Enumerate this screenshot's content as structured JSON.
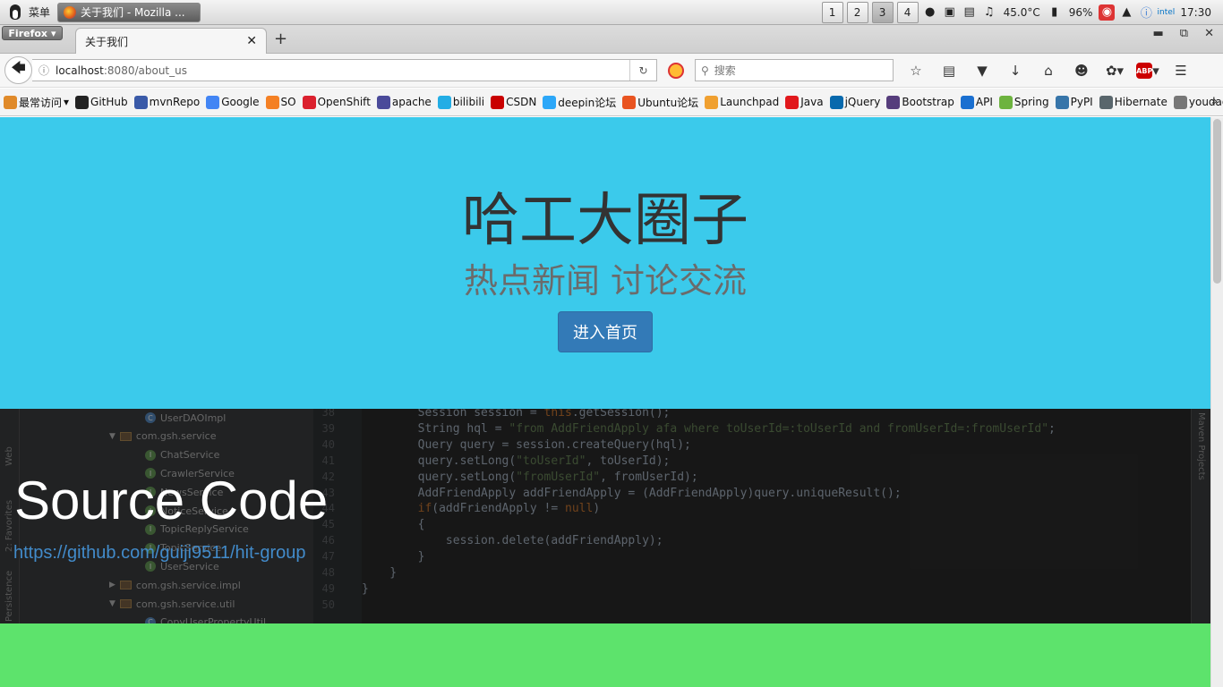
{
  "system_panel": {
    "menu_label": "菜单",
    "task_title": "关于我们 - Mozilla ...",
    "workspaces": [
      "1",
      "2",
      "3",
      "4"
    ],
    "active_workspace": "3",
    "temperature": "45.0°C",
    "battery": "96%",
    "clock": "17:30"
  },
  "browser": {
    "app_menu": "Firefox",
    "tab_title": "关于我们",
    "url_host": "localhost",
    "url_path": ":8080/about_us",
    "search_placeholder": "搜索"
  },
  "bookmarks": [
    {
      "label": "最常访问",
      "color": "#e08a2a"
    },
    {
      "label": "GitHub",
      "color": "#222222"
    },
    {
      "label": "mvnRepo",
      "color": "#3a5aa8"
    },
    {
      "label": "Google",
      "color": "#4285f4"
    },
    {
      "label": "SO",
      "color": "#f48024"
    },
    {
      "label": "OpenShift",
      "color": "#db212e"
    },
    {
      "label": "apache",
      "color": "#4a4a9a"
    },
    {
      "label": "bilibili",
      "color": "#23ade5"
    },
    {
      "label": "CSDN",
      "color": "#c90000"
    },
    {
      "label": "deepin论坛",
      "color": "#2ca7f8"
    },
    {
      "label": "Ubuntu论坛",
      "color": "#e95420"
    },
    {
      "label": "Launchpad",
      "color": "#f0a030"
    },
    {
      "label": "Java",
      "color": "#e1181c"
    },
    {
      "label": "jQuery",
      "color": "#0769ad"
    },
    {
      "label": "Bootstrap",
      "color": "#563d7c"
    },
    {
      "label": "API",
      "color": "#1a6fd0"
    },
    {
      "label": "Spring",
      "color": "#6db33f"
    },
    {
      "label": "PyPI",
      "color": "#3775a9"
    },
    {
      "label": "Hibernate",
      "color": "#59666c"
    },
    {
      "label": "youdao",
      "color": "#777777"
    }
  ],
  "hero": {
    "title": "哈工大圈子",
    "subtitle": "热点新闻 讨论交流",
    "button": "进入首页"
  },
  "source_section": {
    "title": "Source Code",
    "link": "https://github.com/guiji9511/hit-group",
    "ide_left_tabs": [
      "Web",
      "2: Favorites",
      "Persistence"
    ],
    "ide_right_tab": "Maven Projects",
    "tree": [
      {
        "label": "UserDAOImpl",
        "kind": "class",
        "indent": 2
      },
      {
        "label": "com.gsh.service",
        "kind": "package",
        "indent": 1,
        "expanded": true
      },
      {
        "label": "ChatService",
        "kind": "interface",
        "indent": 2
      },
      {
        "label": "CrawlerService",
        "kind": "interface",
        "indent": 2
      },
      {
        "label": "NewsService",
        "kind": "interface",
        "indent": 2
      },
      {
        "label": "NoticeService",
        "kind": "interface",
        "indent": 2
      },
      {
        "label": "TopicReplyService",
        "kind": "interface",
        "indent": 2
      },
      {
        "label": "TopicService",
        "kind": "interface",
        "indent": 2
      },
      {
        "label": "UserService",
        "kind": "interface",
        "indent": 2
      },
      {
        "label": "com.gsh.service.impl",
        "kind": "package",
        "indent": 1,
        "expanded": false
      },
      {
        "label": "com.gsh.service.util",
        "kind": "package",
        "indent": 1,
        "expanded": true
      },
      {
        "label": "CopyUserPropertyUtil",
        "kind": "class",
        "indent": 2
      }
    ],
    "line_numbers": [
      "38",
      "39",
      "40",
      "41",
      "42",
      "43",
      "44",
      "45",
      "46",
      "47",
      "48",
      "49",
      "50"
    ],
    "code_lines": [
      "        Session session = this.getSession();",
      "        String hql = \"from AddFriendApply afa where toUserId=:toUserId and fromUserId=:fromUserId\";",
      "        Query query = session.createQuery(hql);",
      "        query.setLong(\"toUserId\", toUserId);",
      "        query.setLong(\"fromUserId\", fromUserId);",
      "        AddFriendApply addFriendApply = (AddFriendApply)query.uniqueResult();",
      "        if(addFriendApply != null)",
      "        {",
      "            session.delete(addFriendApply);",
      "        }",
      "    }",
      "}",
      ""
    ]
  }
}
